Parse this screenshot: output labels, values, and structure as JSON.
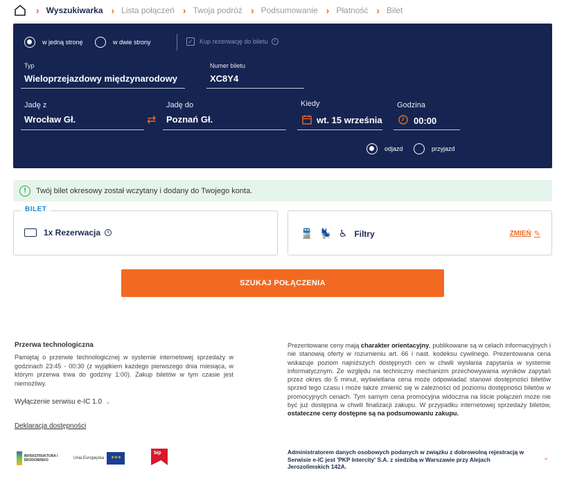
{
  "breadcrumb": {
    "steps": [
      "Wyszukiwarka",
      "Lista połączeń",
      "Twoja podróż",
      "Podsumowanie",
      "Płatność",
      "Bilet"
    ]
  },
  "trip": {
    "one_way": "w jedną stronę",
    "return": "w dwie strony",
    "reserve_checkbox": "Kup rezerwację do biletu"
  },
  "ticket": {
    "type_label": "Typ",
    "type_value": "Wieloprzejazdowy międzynarodowy",
    "number_label": "Numer biletu",
    "number_value": "XC8Y4"
  },
  "route": {
    "from_label": "Jadę z",
    "from_value": "Wrocław Gł.",
    "to_label": "Jadę do",
    "to_value": "Poznań Gł.",
    "date_label": "Kiedy",
    "date_value": "wt. 15 września",
    "time_label": "Godzina",
    "time_value": "00:00",
    "departure": "odjazd",
    "arrival": "przyjazd"
  },
  "alert": "Twój bilet okresowy został wczytany i dodany do Twojego konta.",
  "bilet": {
    "legend": "BILET",
    "reservation": "1x Rezerwacja"
  },
  "filters": {
    "label": "Filtry",
    "edit": "ZMIEŃ"
  },
  "search_button": "SZUKAJ POŁĄCZENIA",
  "footer": {
    "maintenance_title": "Przerwa technologiczna",
    "maintenance_text": "Pamiętaj o przerwie technologicznej w systemie internetowej sprzedaży w godzinach 23:45 - 00:30 (z wyjątkiem każdego pierwszego dnia miesiąca, w którym przerwa trwa do godziny 1:00). Zakup biletów w tym czasie jest niemożliwy.",
    "eic_off": "Wyłączenie serwisu e-IC 1.0",
    "accessibility": "Deklaracja dostępności",
    "logo1": "INFRASTRUKTURA I ŚRODOWISKO",
    "logo2": "Unia Europejska",
    "logo3": "bip",
    "prices_p1": "Prezentowane ceny mają",
    "prices_b1": "charakter orientacyjny",
    "prices_p2": ", publikowane są w celach informacyjnych i nie stanowią oferty w rozumieniu art. 66 i nast. kodeksu cywilnego. Prezentowana cena wskazuje poziom najniższych dostępnych cen w chwili wysłania zapytania w systemie informatycznym. Ze względu na techniczny mechanizm przechowywania wyników zapytań przez okres do 5 minut, wyświetlana cena może odpowiadać stanowi dostępności biletów sprzed tego czasu i może także zmienić się w zależności od poziomu dostępności biletów w promocyjnych cenach. Tym samym cena promocyjna widoczna na liście połączeń może nie być już dostępna w chwili finalizacji zakupu. W przypadku internetowej sprzedaży biletów,",
    "prices_b2": "ostateczne ceny dostępne są na podsumowaniu zakupu.",
    "admin_note": "Administratorem danych osobowych podanych w związku z dobrowolną rejestracją w Serwisie e-IC jest 'PKP Intercity' S.A. z siedzibą w Warszawie przy Alejach Jerozolimskich 142A."
  },
  "colors": {
    "navy": "#152451",
    "accent": "#f26a21",
    "success": "#2f9d4c"
  }
}
